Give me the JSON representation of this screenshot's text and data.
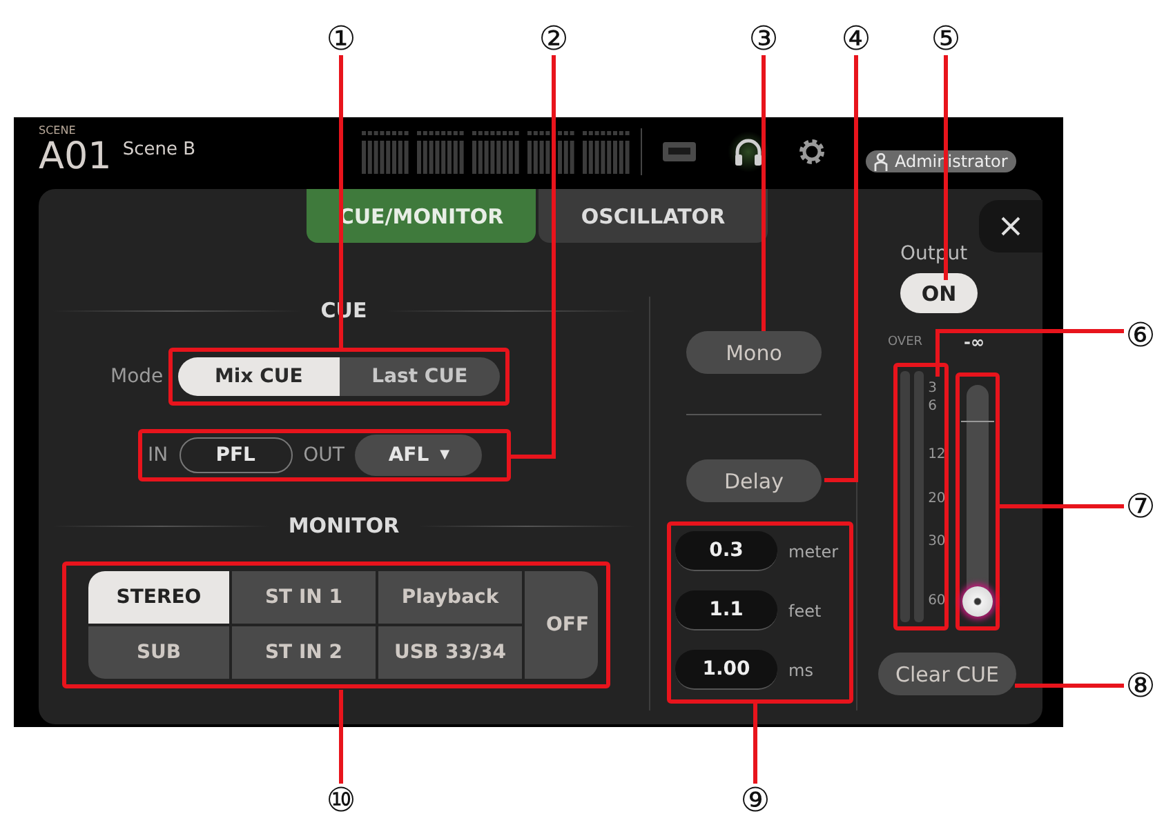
{
  "header": {
    "scene_label": "SCENE",
    "scene_number": "A01",
    "scene_name": "Scene B",
    "user": "Administrator"
  },
  "tabs": [
    {
      "label": "CUE/MONITOR",
      "selected": true
    },
    {
      "label": "OSCILLATOR",
      "selected": false
    }
  ],
  "cue": {
    "title": "CUE",
    "mode_label": "Mode",
    "modes": [
      {
        "label": "Mix CUE",
        "selected": true
      },
      {
        "label": "Last CUE",
        "selected": false
      }
    ],
    "in_label": "IN",
    "in_value": "PFL",
    "out_label": "OUT",
    "out_value": "AFL",
    "out_caret": "▼"
  },
  "monitor": {
    "title": "MONITOR",
    "sources": [
      {
        "label": "STEREO",
        "selected": true
      },
      {
        "label": "ST IN 1",
        "selected": false
      },
      {
        "label": "Playback",
        "selected": false
      },
      {
        "label": "SUB",
        "selected": false
      },
      {
        "label": "ST IN 2",
        "selected": false
      },
      {
        "label": "USB 33/34",
        "selected": false
      }
    ],
    "off": {
      "label": "OFF",
      "selected": false
    }
  },
  "mono": {
    "label": "Mono",
    "on": false
  },
  "delay": {
    "label": "Delay",
    "on": false
  },
  "delay_fields": [
    {
      "value": "0.3",
      "unit": "meter"
    },
    {
      "value": "1.1",
      "unit": "feet"
    },
    {
      "value": "1.00",
      "unit": "ms"
    }
  ],
  "output": {
    "label": "Output",
    "button": "ON",
    "on": true
  },
  "meter": {
    "over_label": "OVER",
    "scale": [
      "3",
      "6",
      "12",
      "20",
      "30",
      "60"
    ]
  },
  "fader": {
    "reading": "-∞",
    "level": 0
  },
  "clear_cue": "Clear CUE",
  "callouts": [
    "①",
    "②",
    "③",
    "④",
    "⑤",
    "⑥",
    "⑦",
    "⑧",
    "⑨",
    "⑩"
  ]
}
